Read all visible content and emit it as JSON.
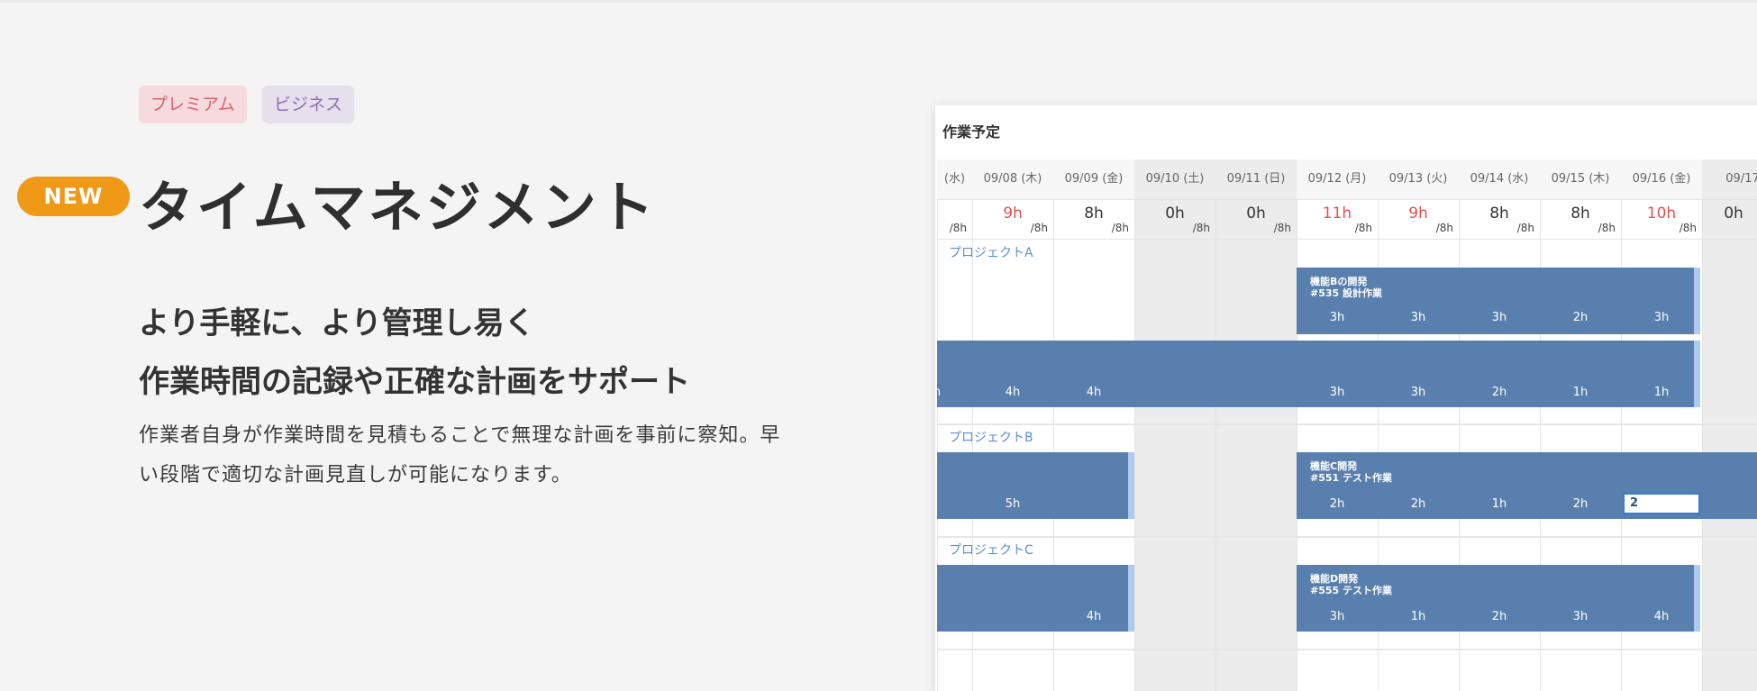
{
  "badges": {
    "premium": "プレミアム",
    "business": "ビジネス"
  },
  "new_label": "NEW",
  "title": "タイムマネジメント",
  "subtitle_line1": "より手軽に、より管理し易く",
  "subtitle_line2": "作業時間の記録や正確な計画をサポート",
  "description": "作業者自身が作業時間を見積もることで無理な計画を事前に察知。早い段階で適切な計画見直しが可能になります。",
  "app": {
    "title": "作業予定",
    "days": [
      {
        "date": "(水)",
        "total": "",
        "cap": "/8h",
        "red": false,
        "weekend": false
      },
      {
        "date": "09/08 (木)",
        "total": "9h",
        "cap": "/8h",
        "red": true,
        "weekend": false
      },
      {
        "date": "09/09 (金)",
        "total": "8h",
        "cap": "/8h",
        "red": false,
        "weekend": false
      },
      {
        "date": "09/10 (土)",
        "total": "0h",
        "cap": "/8h",
        "red": false,
        "weekend": true
      },
      {
        "date": "09/11 (日)",
        "total": "0h",
        "cap": "/8h",
        "red": false,
        "weekend": true
      },
      {
        "date": "09/12 (月)",
        "total": "11h",
        "cap": "/8h",
        "red": true,
        "weekend": false
      },
      {
        "date": "09/13 (火)",
        "total": "9h",
        "cap": "/8h",
        "red": true,
        "weekend": false
      },
      {
        "date": "09/14 (水)",
        "total": "8h",
        "cap": "/8h",
        "red": false,
        "weekend": false
      },
      {
        "date": "09/15 (木)",
        "total": "8h",
        "cap": "/8h",
        "red": false,
        "weekend": false
      },
      {
        "date": "09/16 (金)",
        "total": "10h",
        "cap": "/8h",
        "red": true,
        "weekend": false
      },
      {
        "date": "09/17",
        "total": "0h",
        "cap": "",
        "red": false,
        "weekend": true
      }
    ],
    "projects": [
      "プロジェクトA",
      "プロジェクトB",
      "プロジェクトC"
    ],
    "bars": {
      "a1": {
        "line1": "機能Bの開発",
        "line2": "#535 設計作業",
        "hours": [
          "3h",
          "3h",
          "3h",
          "2h",
          "3h"
        ]
      },
      "a2": {
        "hours": [
          "h",
          "4h",
          "4h",
          "3h",
          "3h",
          "2h",
          "1h",
          "1h"
        ]
      },
      "b1": {
        "hours": [
          "5h"
        ]
      },
      "b2": {
        "line1": "機能C開発",
        "line2": "#551 テスト作業",
        "hours": [
          "2h",
          "2h",
          "1h",
          "2h"
        ],
        "editing_value": "2"
      },
      "c1": {
        "hours": [
          "4h"
        ]
      },
      "c2": {
        "line1": "機能D開発",
        "line2": "#555 テスト作業",
        "hours": [
          "3h",
          "1h",
          "2h",
          "3h",
          "4h"
        ]
      }
    }
  },
  "colors": {
    "accent_orange": "#ef9917",
    "bar_blue": "#587fad",
    "over_red": "#e55050",
    "project_blue": "#5b8fd6"
  },
  "icons": {
    "back": "chevron-left-icon"
  }
}
